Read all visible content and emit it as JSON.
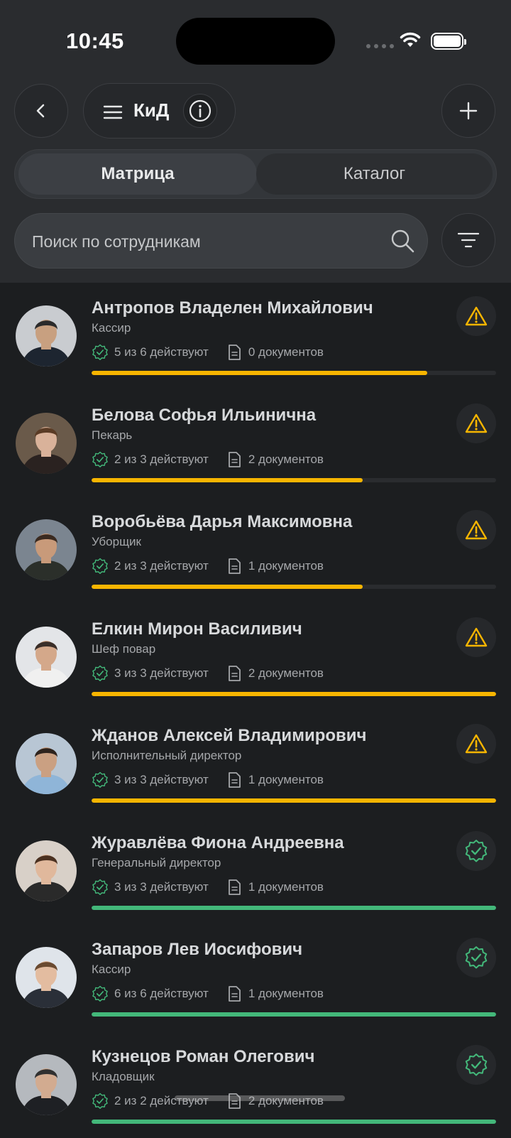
{
  "status_bar": {
    "time": "10:45"
  },
  "header": {
    "title": "КиД"
  },
  "tabs": [
    {
      "label": "Матрица",
      "active": true
    },
    {
      "label": "Каталог",
      "active": false
    }
  ],
  "search": {
    "placeholder": "Поиск по сотрудникам",
    "value": ""
  },
  "colors": {
    "warning": "#f7b500",
    "ok": "#43b87a",
    "track": "#2a2c2f"
  },
  "employees": [
    {
      "name": "Антропов Владелен Михайлович",
      "role": "Кассир",
      "active": "5 из 6 действуют",
      "docs": "0 документов",
      "progress": 0.83,
      "status": "warning"
    },
    {
      "name": "Белова Софья Ильинична",
      "role": "Пекарь",
      "active": "2 из 3 действуют",
      "docs": "2 документов",
      "progress": 0.67,
      "status": "warning"
    },
    {
      "name": "Воробьёва Дарья Максимовна",
      "role": "Уборщик",
      "active": "2 из 3 действуют",
      "docs": "1 документов",
      "progress": 0.67,
      "status": "warning"
    },
    {
      "name": "Елкин Мирон Василивич",
      "role": "Шеф повар",
      "active": "3 из 3 действуют",
      "docs": "2 документов",
      "progress": 1.0,
      "status": "warning"
    },
    {
      "name": "Жданов Алексей Владимирович",
      "role": "Исполнительный директор",
      "active": "3 из 3 действуют",
      "docs": "1 документов",
      "progress": 1.0,
      "status": "warning"
    },
    {
      "name": "Журавлёва Фиона Андреевна",
      "role": "Генеральный директор",
      "active": "3 из 3 действуют",
      "docs": "1 документов",
      "progress": 1.0,
      "status": "ok"
    },
    {
      "name": "Запаров Лев Иосифович",
      "role": "Кассир",
      "active": "6 из 6 действуют",
      "docs": "1 документов",
      "progress": 1.0,
      "status": "ok"
    },
    {
      "name": "Кузнецов Роман Олегович",
      "role": "Кладовщик",
      "active": "2 из 2 действуют",
      "docs": "2 документов",
      "progress": 1.0,
      "status": "ok"
    }
  ]
}
